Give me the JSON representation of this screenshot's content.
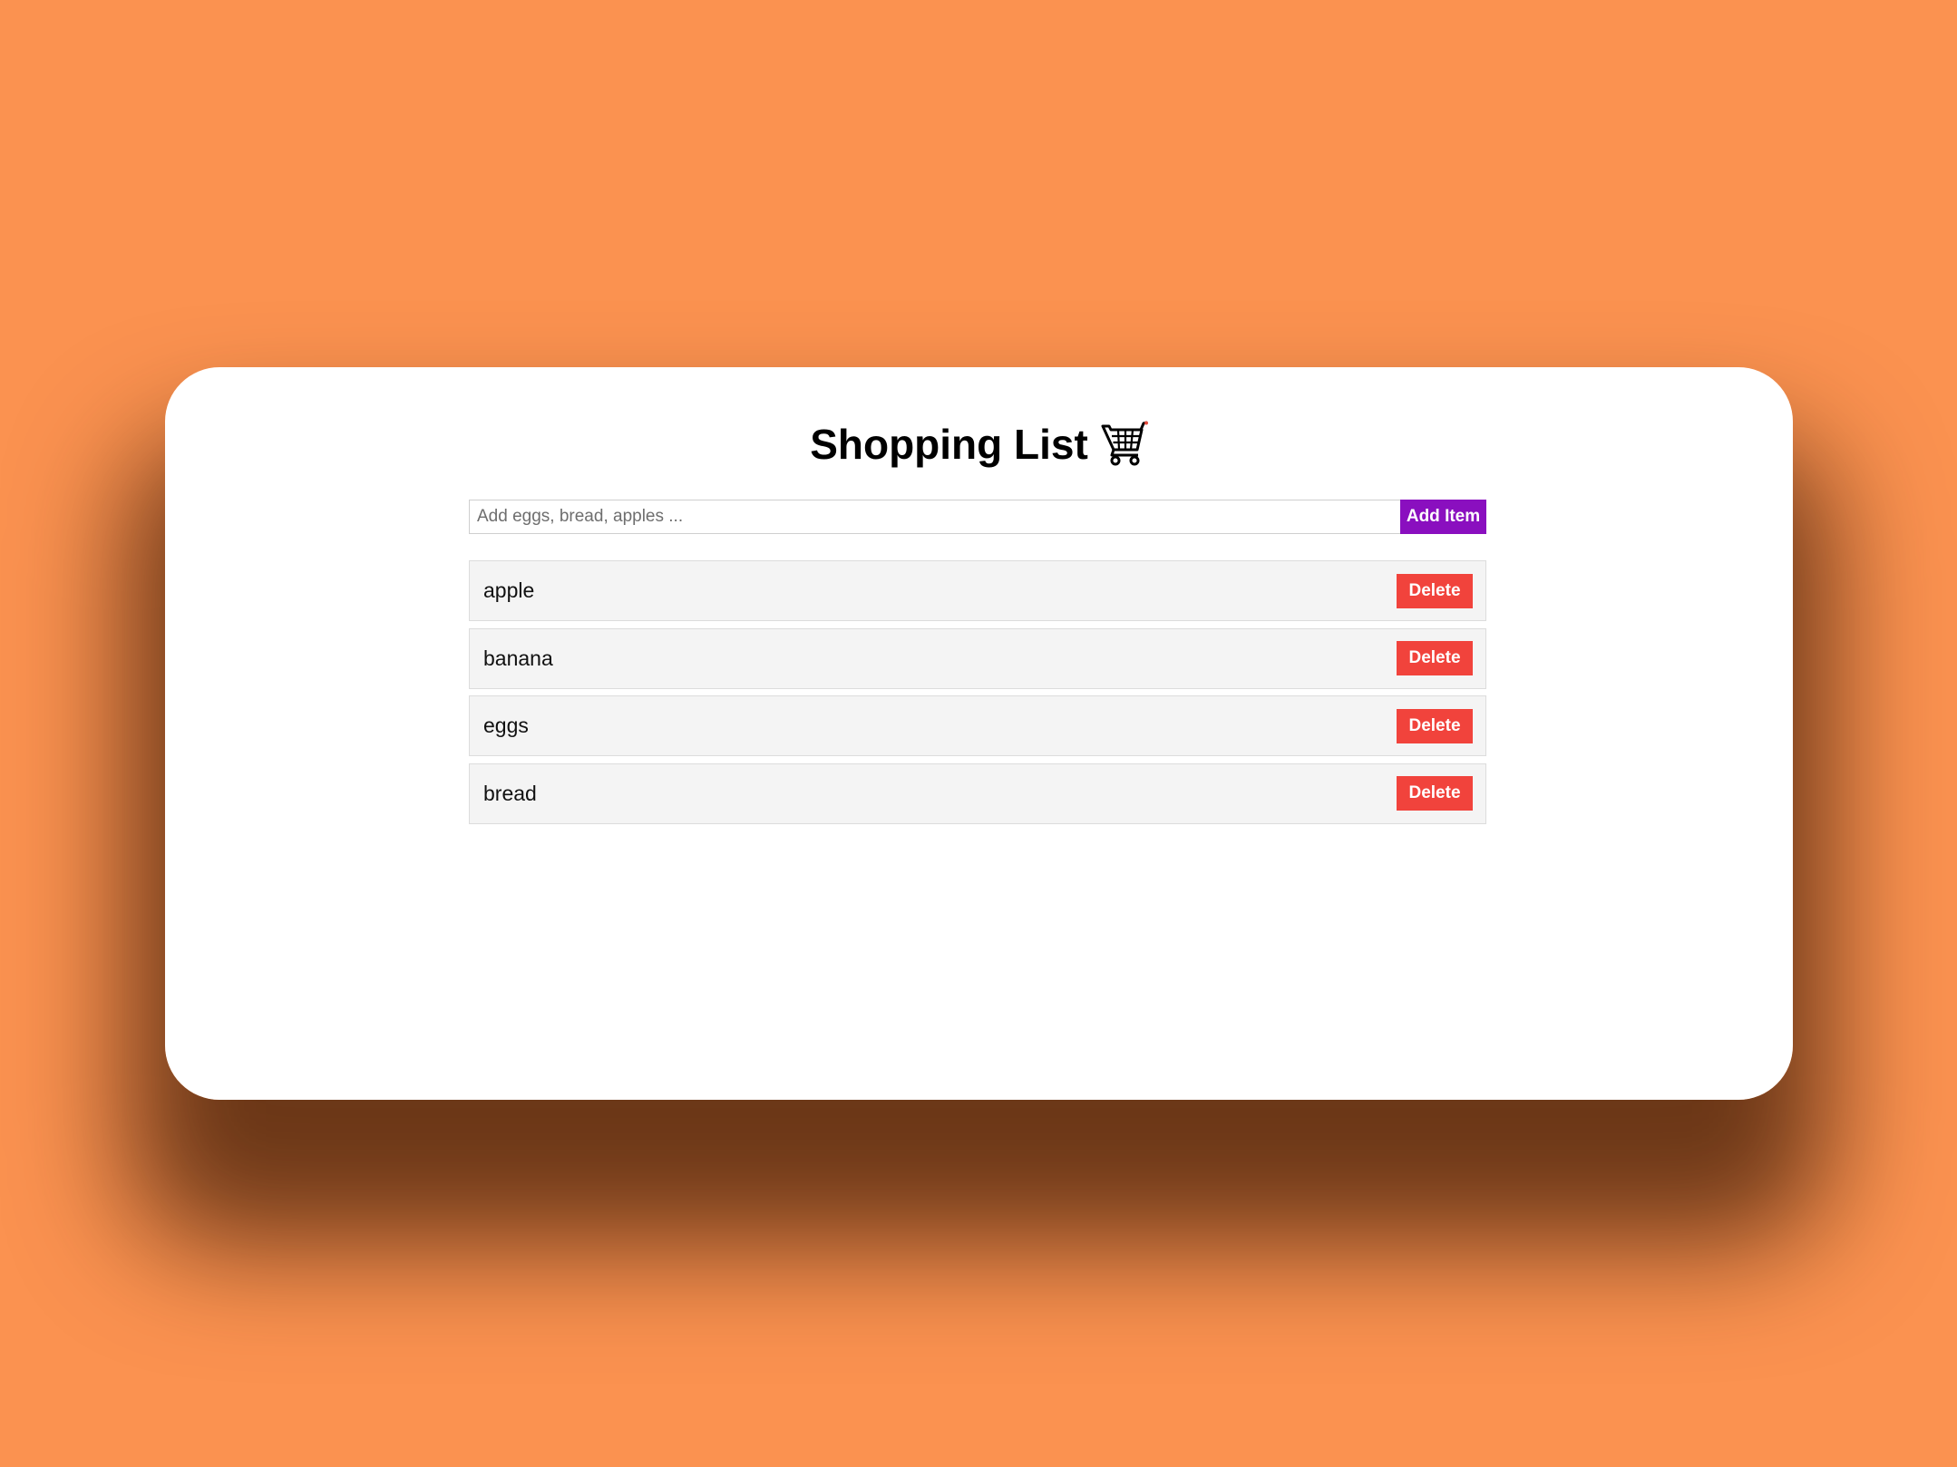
{
  "app": {
    "title": "Shopping List",
    "title_icon": "shopping-cart-icon"
  },
  "form": {
    "input_value": "",
    "input_placeholder": "Add eggs, bread, apples ...",
    "add_label": "Add Item"
  },
  "items": [
    {
      "name": "apple",
      "delete_label": "Delete"
    },
    {
      "name": "banana",
      "delete_label": "Delete"
    },
    {
      "name": "eggs",
      "delete_label": "Delete"
    },
    {
      "name": "bread",
      "delete_label": "Delete"
    }
  ],
  "colors": {
    "background": "#fb9250",
    "add_button": "#8a0fbf",
    "delete_button": "#f1433c",
    "item_background": "#f4f4f4"
  }
}
